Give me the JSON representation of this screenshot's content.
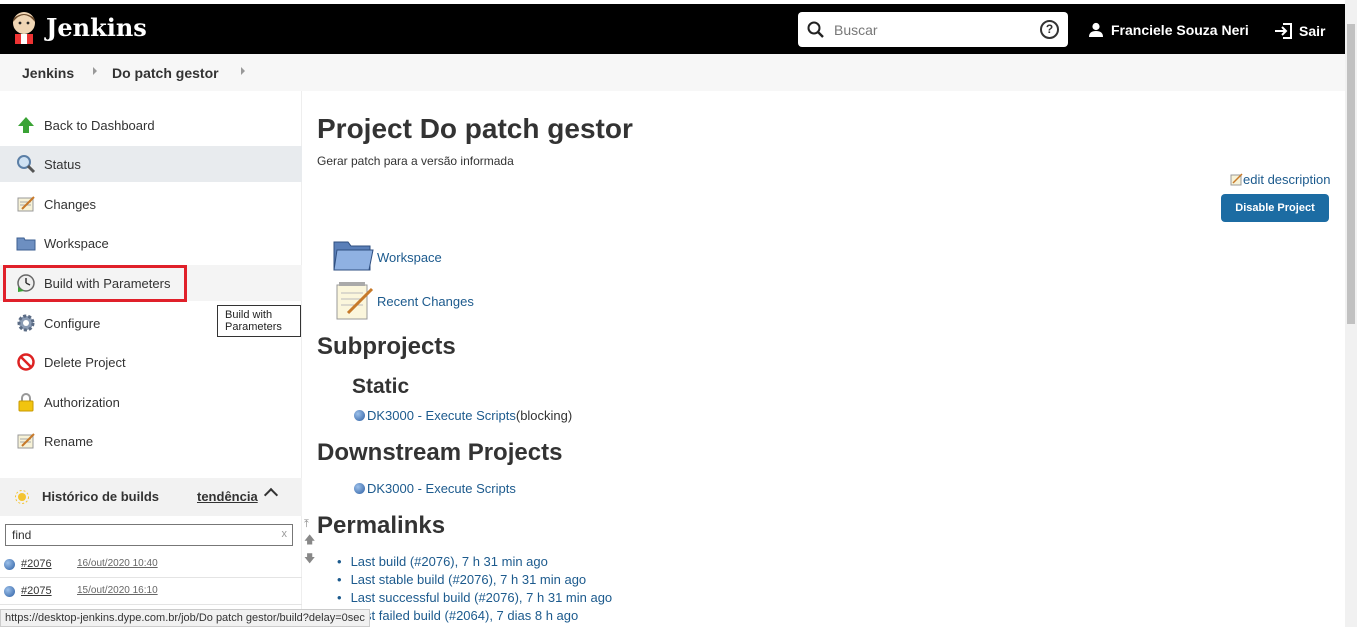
{
  "header": {
    "title": "Jenkins",
    "search_placeholder": "Buscar",
    "user_name": "Franciele Souza Neri",
    "logout_label": "Sair"
  },
  "breadcrumb": [
    "Jenkins",
    "Do patch gestor"
  ],
  "sidebar": {
    "items": [
      {
        "label": "Back to Dashboard",
        "icon": "up-arrow-icon"
      },
      {
        "label": "Status",
        "icon": "magnifier-icon"
      },
      {
        "label": "Changes",
        "icon": "notepad-icon"
      },
      {
        "label": "Workspace",
        "icon": "folder-icon"
      },
      {
        "label": "Build with Parameters",
        "icon": "clock-build-icon"
      },
      {
        "label": "Configure",
        "icon": "gear-icon"
      },
      {
        "label": "Delete Project",
        "icon": "no-entry-icon"
      },
      {
        "label": "Authorization",
        "icon": "lock-icon"
      },
      {
        "label": "Rename",
        "icon": "notepad-icon"
      }
    ],
    "tooltip": "Build with Parameters",
    "history": {
      "title": "Histórico de builds",
      "trend_label": "tendência",
      "find_placeholder": "find",
      "find_clear": "x",
      "builds": [
        {
          "number": "#2076",
          "date": "16/out/2020 10:40"
        },
        {
          "number": "#2075",
          "date": "15/out/2020 16:10"
        }
      ]
    }
  },
  "status_url": "https://desktop-jenkins.dype.com.br/job/Do patch gestor/build?delay=0sec",
  "main": {
    "title": "Project Do patch gestor",
    "description": "Gerar patch para a versão informada",
    "edit_description": "edit description",
    "disable_button": "Disable Project",
    "workspace_link": "Workspace",
    "recent_changes_link": "Recent Changes",
    "subprojects_heading": "Subprojects",
    "static_heading": "Static",
    "static_project": "DK3000 - Execute Scripts",
    "static_suffix": "(blocking)",
    "downstream_heading": "Downstream Projects",
    "downstream_project": "DK3000 - Execute Scripts",
    "permalinks_heading": "Permalinks",
    "permalinks": [
      "Last build (#2076), 7 h 31 min ago",
      "Last stable build (#2076), 7 h 31 min ago",
      "Last successful build (#2076), 7 h 31 min ago",
      "Last failed build (#2064), 7 dias 8 h ago"
    ]
  },
  "colors": {
    "header_bg": "#000000",
    "link": "#1c5a8d",
    "button": "#1c6ca3",
    "highlight": "#e0202a"
  }
}
